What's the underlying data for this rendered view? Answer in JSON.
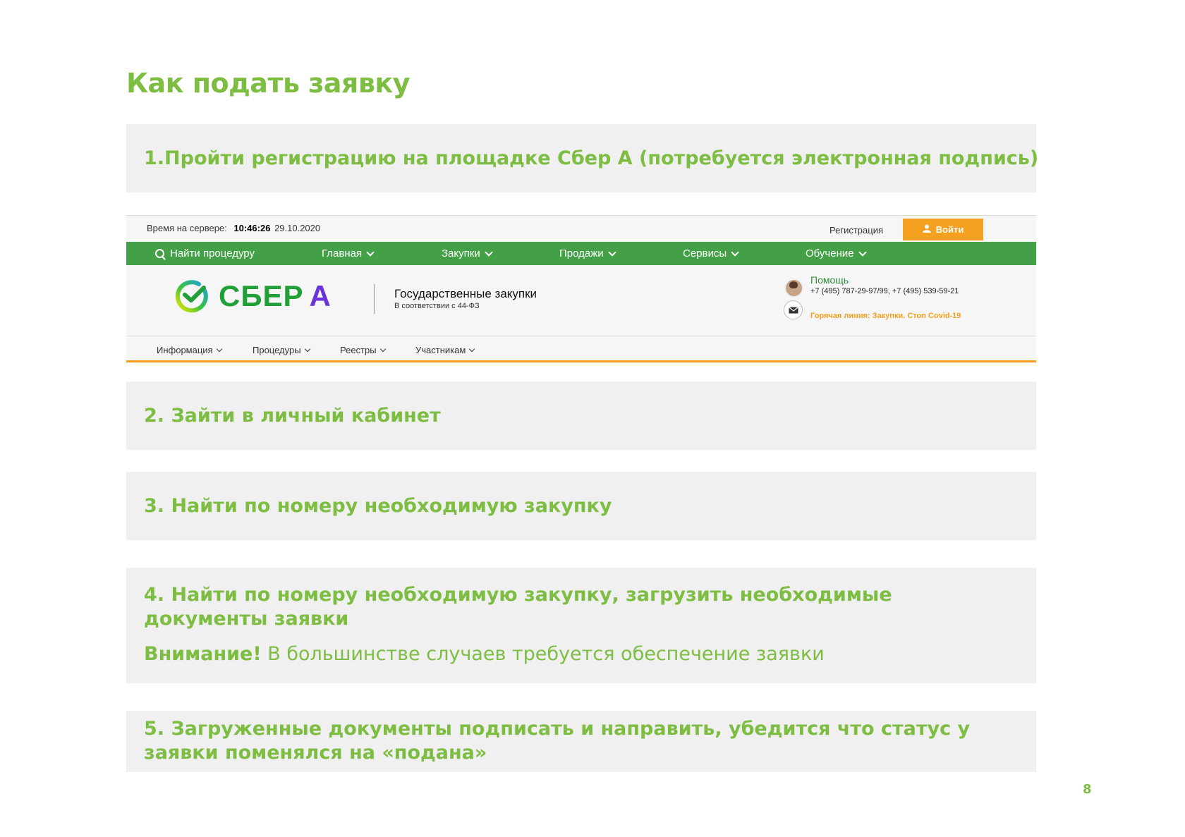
{
  "title": "Как подать заявку",
  "steps": {
    "s1_num": "1.",
    "s1_text": "Пройти регистрацию на площадке Сбер А (потребуется электронная подпись)",
    "s2": "2. Зайти в личный кабинет",
    "s3": "3. Найти по номеру необходимую закупку",
    "s4": "4. Найти по номеру необходимую закупку, загрузить необходимые документы заявки",
    "s4_warn_label": "Внимание!",
    "s4_warn_text": " В большинстве случаев требуется обеспечение заявки",
    "s5": "5. Загруженные документы подписать и направить, убедится что статус у заявки поменялся на «подана»"
  },
  "site": {
    "server_time_label": "Время на сервере:",
    "server_time": "10:46:26",
    "server_date": "29.10.2020",
    "register": "Регистрация",
    "login": "Войти",
    "nav": [
      "Найти процедуру",
      "Главная",
      "Закупки",
      "Продажи",
      "Сервисы",
      "Обучение"
    ],
    "logo_text": "СБЕР",
    "logo_letter": "А",
    "section_title": "Государственные закупки",
    "section_sub": "В соответствии с 44-ФЗ",
    "help": "Помощь",
    "phones": "+7 (495) 787-29-97/99, +7 (495) 539-59-21",
    "hotline": "Горячая линия: Закупки. Стоп Covid-19",
    "subnav": [
      "Информация",
      "Процедуры",
      "Реестры",
      "Участникам"
    ],
    "colors": {
      "green": "#43a047",
      "orange": "#f5a01e",
      "purple": "#6a32d8"
    }
  },
  "page_number": "8",
  "accent_color": "#7cbd42"
}
